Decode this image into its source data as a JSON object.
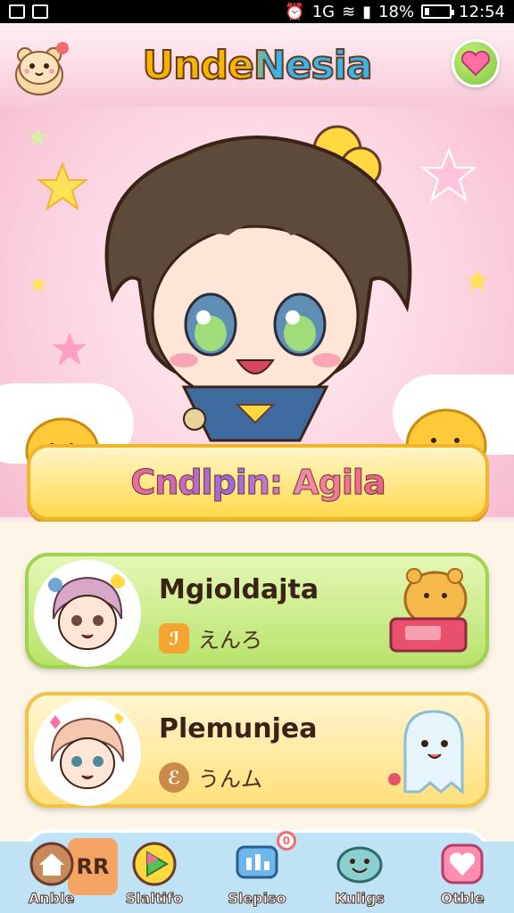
{
  "status_bar": {
    "signal_text": "1G",
    "battery_text": "18%",
    "time": "12:54",
    "battery_level": 0.18
  },
  "header": {
    "title": "UndeNesia",
    "left_icon": "hamster-mascot-icon",
    "right_icon": "heart-icon"
  },
  "hero": {
    "banner_text": "Cndlpin: Agila"
  },
  "cards": [
    {
      "title": "Mgioldajta",
      "subtitle": "えんろ",
      "sub_icon_glyph": "ℐ",
      "art_icon": "laptop-bear-icon",
      "accent": "#9fd24e"
    },
    {
      "title": "Plemunjea",
      "subtitle": "うんム",
      "sub_icon_glyph": "ℰ",
      "art_icon": "ghost-icon",
      "accent": "#f1c24a"
    }
  ],
  "bottom_nav": {
    "tag_text": "RR",
    "badge_text": "0",
    "items": [
      {
        "label": "Anble",
        "icon": "home-icon"
      },
      {
        "label": "Slaltifo",
        "icon": "play-icon"
      },
      {
        "label": "Slepiso",
        "icon": "chat-icon"
      },
      {
        "label": "Kuligs",
        "icon": "smiley-icon"
      },
      {
        "label": "Otble",
        "icon": "heart-icon"
      }
    ]
  }
}
